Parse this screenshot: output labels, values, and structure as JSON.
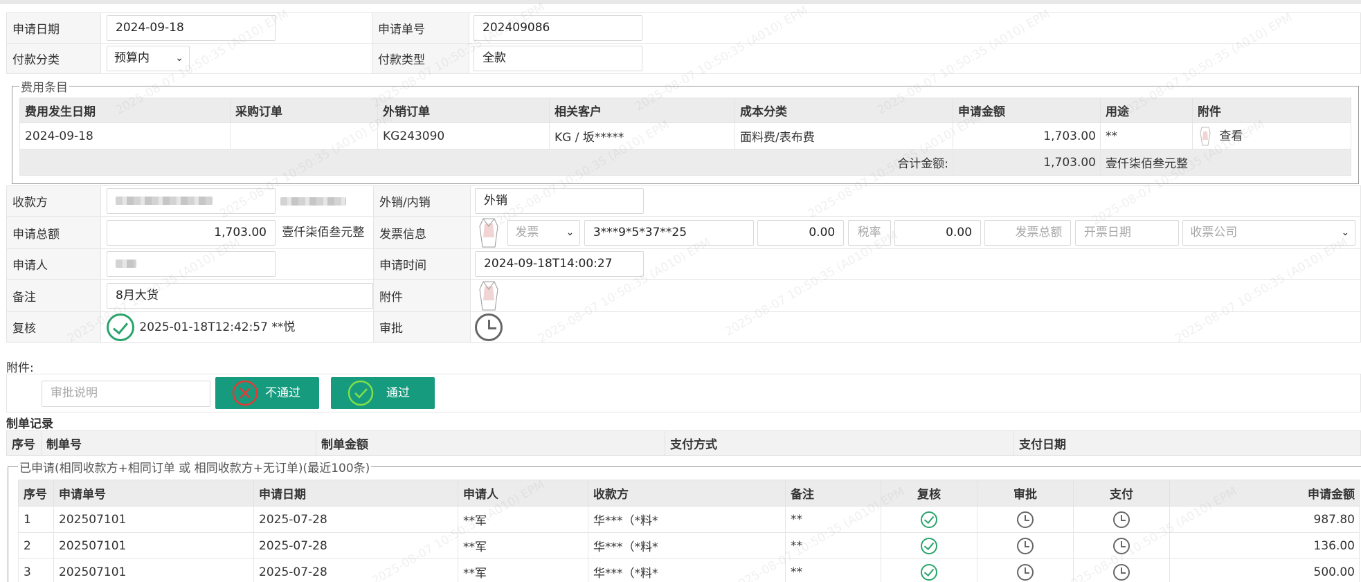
{
  "form": {
    "apply_date_label": "申请日期",
    "apply_date_value": "2024-09-18",
    "apply_no_label": "申请单号",
    "apply_no_value": "202409086",
    "pay_category_label": "付款分类",
    "pay_category_value": "预算内",
    "pay_type_label": "付款类型",
    "pay_type_value": "全款",
    "payee_label": "收款方",
    "export_label": "外销/内销",
    "export_value": "外销",
    "total_label": "申请总额",
    "total_value": "1,703.00",
    "total_words": "壹仟柒佰叁元整",
    "invoice_label": "发票信息",
    "invoice_type_placeholder": "发票",
    "invoice_no": "3***9*5*37**25",
    "invoice_amount": "0.00",
    "tax_rate_placeholder": "税率",
    "tax_amount": "0.00",
    "invoice_total_placeholder": "发票总额",
    "invoice_date_placeholder": "开票日期",
    "invoice_company_placeholder": "收票公司",
    "applicant_label": "申请人",
    "apply_time_label": "申请时间",
    "apply_time_value": "2024-09-18T14:00:27",
    "remark_label": "备注",
    "remark_value": "8月大货",
    "attachment_label": "附件",
    "review_label": "复核",
    "review_value": "2025-01-18T12:42:57 **悦",
    "approve_label": "审批"
  },
  "fees": {
    "legend": "费用条目",
    "headers": [
      "费用发生日期",
      "采购订单",
      "外销订单",
      "相关客户",
      "成本分类",
      "申请金额",
      "用途",
      "附件"
    ],
    "row": {
      "date": "2024-09-18",
      "po": "",
      "so": "KG243090",
      "customer": "KG / 坂*****",
      "cost": "面料费/表布费",
      "amount": "1,703.00",
      "usage": "**",
      "attach": "查看"
    },
    "sum_label": "合计金额:",
    "sum_amount": "1,703.00",
    "sum_words": "壹仟柒佰叁元整"
  },
  "approval": {
    "attachments_label": "附件:",
    "comment_placeholder": "审批说明",
    "reject_label": "不通过",
    "approve_label": "通过"
  },
  "make_records": {
    "title": "制单记录",
    "headers": [
      "序号",
      "制单号",
      "制单金额",
      "支付方式",
      "支付日期"
    ]
  },
  "history": {
    "legend": "已申请(相同收款方+相同订单 或 相同收款方+无订单)(最近100条)",
    "headers": [
      "序号",
      "申请单号",
      "申请日期",
      "申请人",
      "收款方",
      "备注",
      "复核",
      "审批",
      "支付",
      "申请金额"
    ],
    "rows": [
      {
        "idx": "1",
        "no": "202507101",
        "date": "2025-07-28",
        "applicant": "**军",
        "payee": "华***（*料*",
        "remark": "**",
        "amount": "987.80"
      },
      {
        "idx": "2",
        "no": "202507101",
        "date": "2025-07-28",
        "applicant": "**军",
        "payee": "华***（*料*",
        "remark": "**",
        "amount": "136.00"
      },
      {
        "idx": "3",
        "no": "202507101",
        "date": "2025-07-28",
        "applicant": "**军",
        "payee": "华***（*料*",
        "remark": "**",
        "amount": "500.00"
      }
    ]
  },
  "watermark": "2025-08-07 10:50:35  (A010) EPM",
  "colors": {
    "primary_button": "#179b7e",
    "approved_icon": "#27a36b",
    "pending_icon": "#666666"
  }
}
